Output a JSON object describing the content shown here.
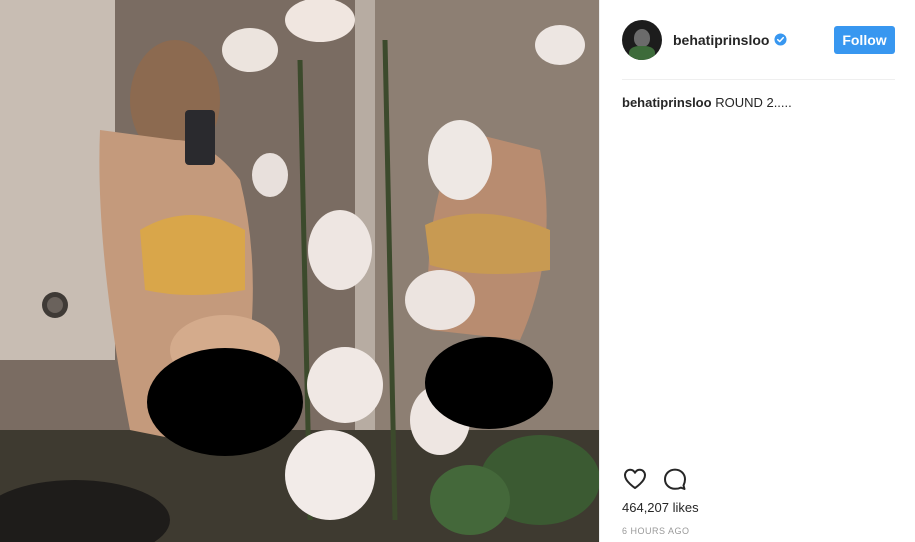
{
  "post": {
    "username": "behatiprinsloo",
    "verified": true,
    "follow_label": "Follow",
    "caption_user": "behatiprinsloo",
    "caption_text": "ROUND 2.....",
    "likes": "464,207 likes",
    "timestamp": "6 HOURS AGO"
  },
  "icons": {
    "avatar": "avatar-icon",
    "verified": "verified-badge-icon",
    "like": "heart-icon",
    "comment": "comment-icon"
  },
  "colors": {
    "follow_button": "#3897f0",
    "verified_badge": "#3897f0",
    "text": "#262626",
    "muted": "#999999"
  }
}
